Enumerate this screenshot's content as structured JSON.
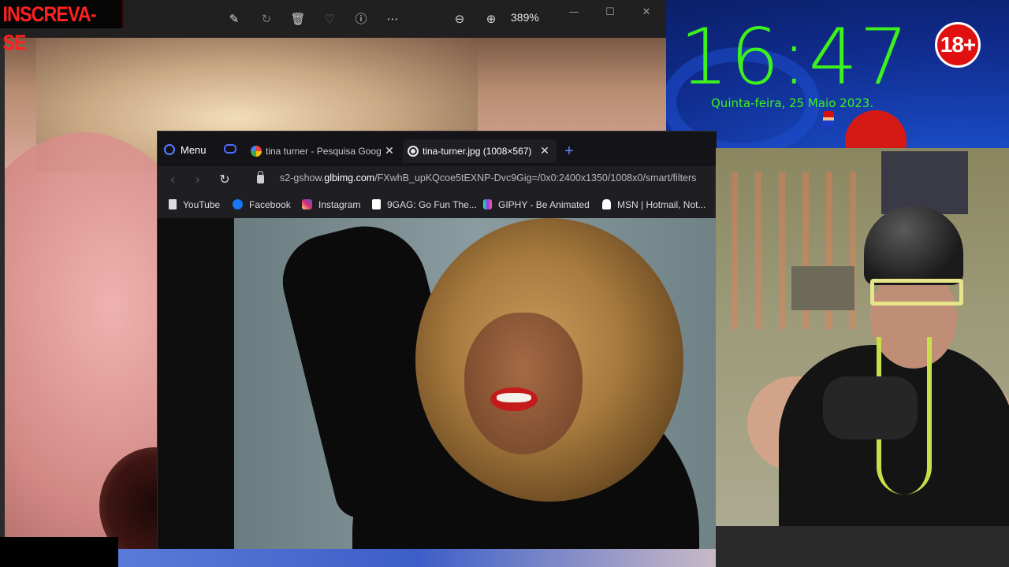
{
  "overlay": {
    "subscribe": "INSCREVA-SE",
    "clock": "16:47",
    "date": "Quinta-feira, 25 Maio 2023.",
    "age_rating": "18+"
  },
  "photos_viewer": {
    "toolbar": {
      "edit_icon": "edit-image-icon",
      "rotate_icon": "rotate-icon",
      "delete_icon": "trash-icon",
      "favorite_icon": "heart-icon",
      "info_icon": "info-icon",
      "more_icon": "more-icon",
      "zoom_out_icon": "zoom-out-icon",
      "zoom_in_icon": "zoom-in-icon",
      "zoom_level": "389%"
    }
  },
  "browser": {
    "menu_label": "Menu",
    "tabs": [
      {
        "title": "tina turner - Pesquisa Goog",
        "favicon": "google-icon",
        "active": false
      },
      {
        "title": "tina-turner.jpg (1008×567)",
        "favicon": "globe-icon",
        "active": true
      }
    ],
    "url_prefix": "s2-gshow.",
    "url_domain": "glbimg.com",
    "url_path": "/FXwhB_upKQcoe5tEXNP-Dvc9Gig=/0x0:2400x1350/1008x0/smart/filters",
    "bookmarks": [
      {
        "label": "YouTube",
        "icon": "bookmark-icon",
        "color": "#dcdcdc"
      },
      {
        "label": "Facebook",
        "icon": "facebook-icon",
        "color": "#1877f2"
      },
      {
        "label": "Instagram",
        "icon": "instagram-icon",
        "color": "#d62976"
      },
      {
        "label": "9GAG: Go Fun The...",
        "icon": "9gag-icon",
        "color": "#ffffff"
      },
      {
        "label": "GIPHY - Be Animated",
        "icon": "giphy-icon",
        "color": "#9933ff"
      },
      {
        "label": "MSN | Hotmail, Not...",
        "icon": "msn-icon",
        "color": "#ffffff"
      }
    ]
  },
  "colors": {
    "clock_green": "#3cf21c",
    "subscribe_red": "#ff2020",
    "opera_blue": "#5b7bff"
  }
}
